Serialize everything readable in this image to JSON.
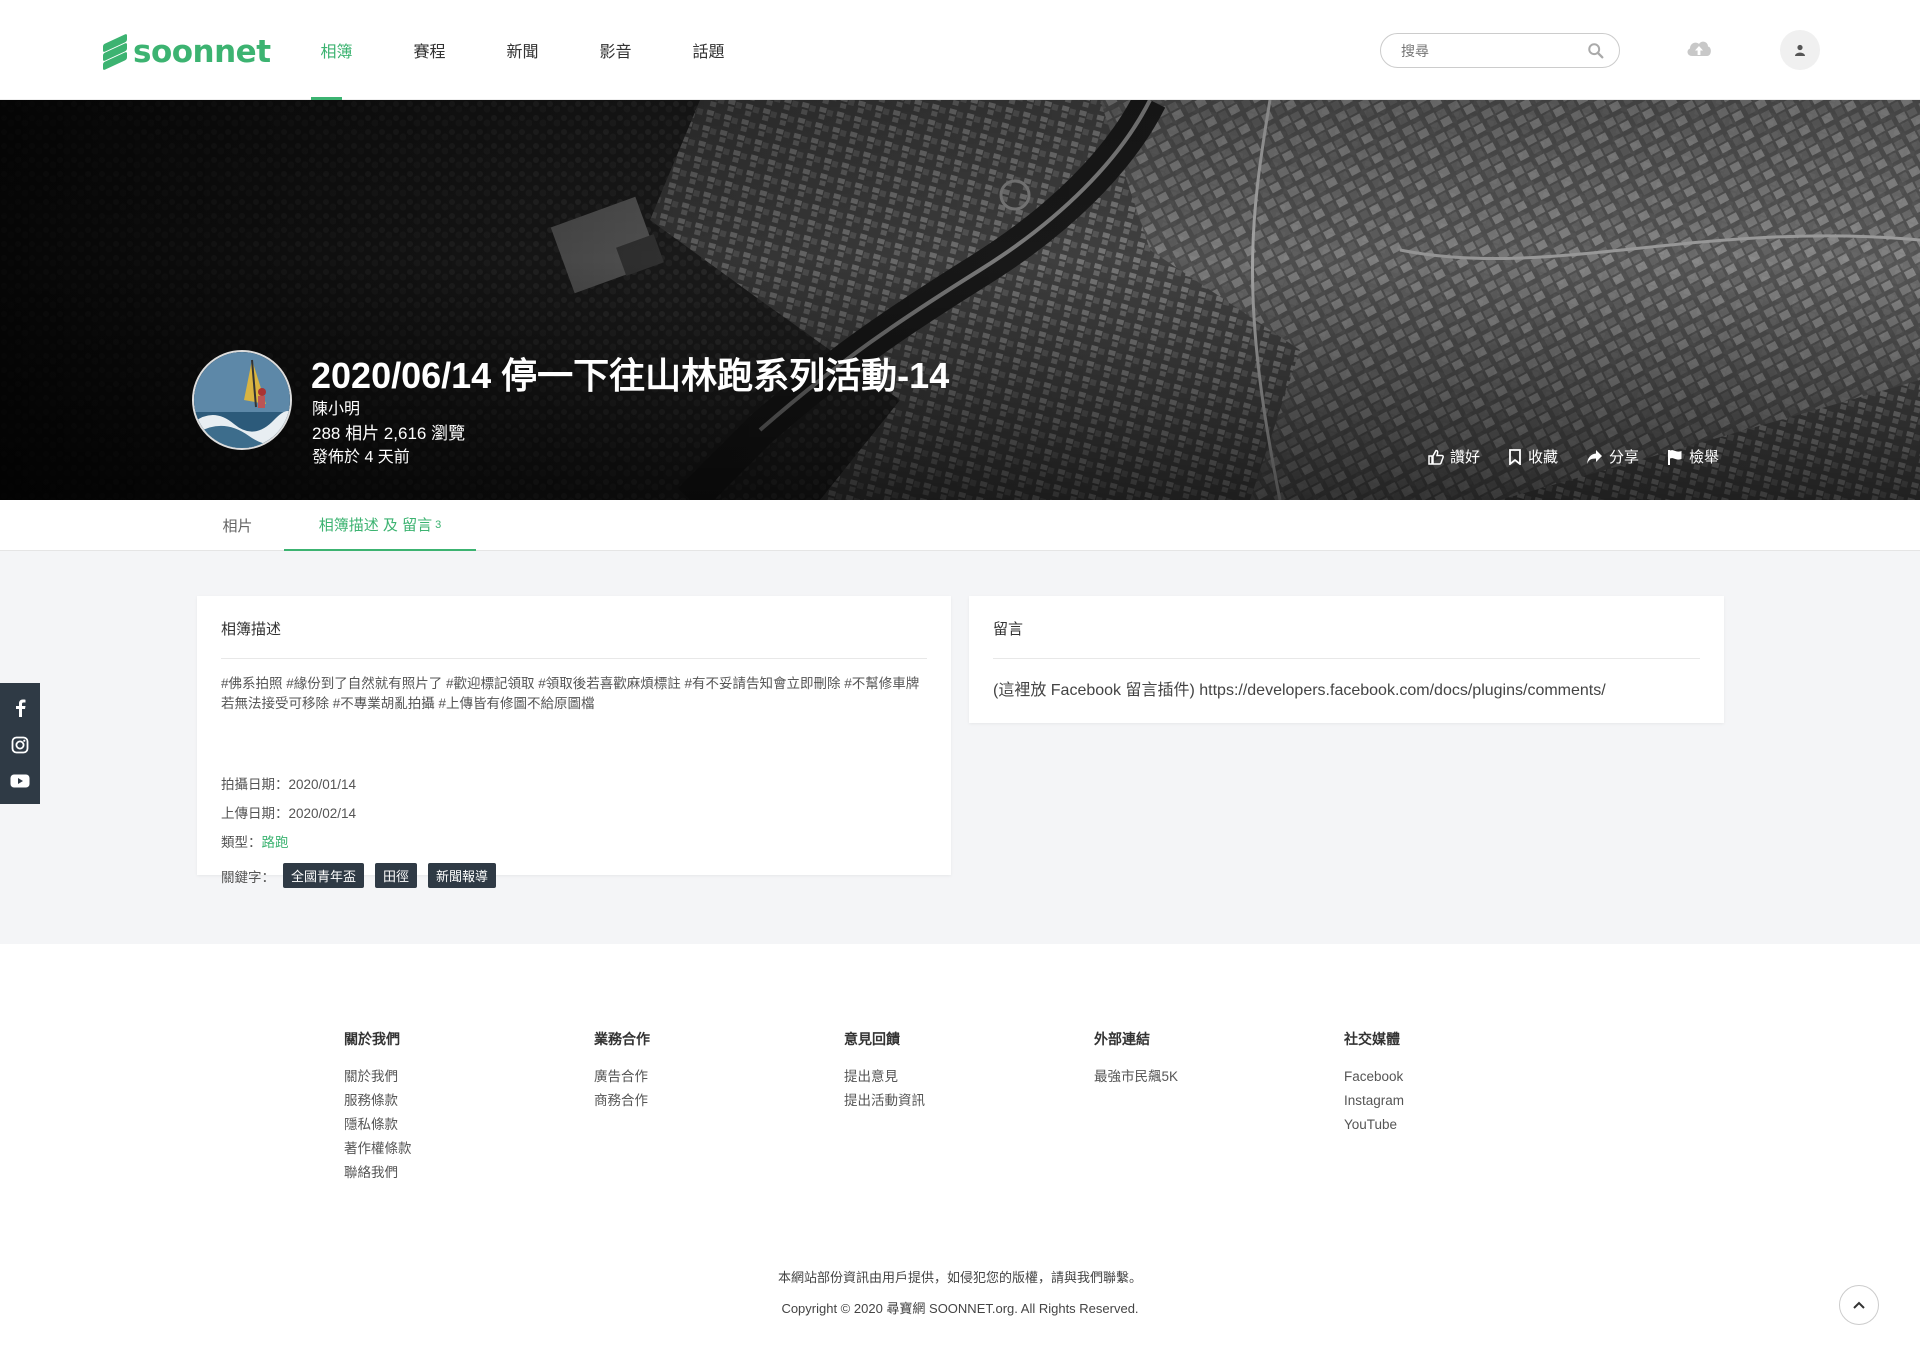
{
  "header": {
    "logo_text": "soonnet",
    "nav": [
      {
        "label": "相簿",
        "active": true
      },
      {
        "label": "賽程",
        "active": false
      },
      {
        "label": "新聞",
        "active": false
      },
      {
        "label": "影音",
        "active": false
      },
      {
        "label": "話題",
        "active": false
      }
    ],
    "search_placeholder": "搜尋"
  },
  "album": {
    "title": "2020/06/14 停一下往山林跑系列活動-14",
    "author": "陳小明",
    "stats": "288 相片 2,616 瀏覽",
    "posted": "發佈於 4 天前",
    "actions": [
      {
        "label": "讚好",
        "icon": "thumbs-up-icon"
      },
      {
        "label": "收藏",
        "icon": "bookmark-icon"
      },
      {
        "label": "分享",
        "icon": "share-icon"
      },
      {
        "label": "檢舉",
        "icon": "flag-icon"
      }
    ]
  },
  "tabs": {
    "photos": "相片",
    "desc_comments": "相簿描述 及 留言",
    "comment_count": "3"
  },
  "description": {
    "heading": "相簿描述",
    "text": "#佛系拍照 #緣份到了自然就有照片了 #歡迎標記領取 #領取後若喜歡麻煩標註 #有不妥請告知會立即刪除 #不幫修車牌若無法接受可移除 #不專業胡亂拍攝 #上傳皆有修圖不給原圖檔",
    "shot_date_label": "拍攝日期：",
    "shot_date": "2020/01/14",
    "upload_date_label": "上傳日期：",
    "upload_date": "2020/02/14",
    "type_label": "類型：",
    "type_value": "路跑",
    "keywords_label": "關鍵字：",
    "keywords": [
      "全國青年盃",
      "田徑",
      "新聞報導"
    ]
  },
  "comments": {
    "heading": "留言",
    "placeholder_text": "(這裡放 Facebook 留言插件) https://developers.facebook.com/docs/plugins/comments/"
  },
  "footer": {
    "columns": [
      {
        "title": "關於我們",
        "links": [
          "關於我們",
          "服務條款",
          "隱私條款",
          "著作權條款",
          "聯絡我們"
        ]
      },
      {
        "title": "業務合作",
        "links": [
          "廣告合作",
          "商務合作"
        ]
      },
      {
        "title": "意見回饋",
        "links": [
          "提出意見",
          "提出活動資訊"
        ]
      },
      {
        "title": "外部連結",
        "links": [
          "最強市民飆5K"
        ]
      },
      {
        "title": "社交媒體",
        "links": [
          "Facebook",
          "Instagram",
          "YouTube"
        ]
      }
    ],
    "notice": "本網站部份資訊由用戶提供，如侵犯您的版權，請與我們聯繫。",
    "copyright": "Copyright © 2020 尋寶網 SOONNET.org. All Rights Reserved."
  },
  "colors": {
    "accent": "#3cb371",
    "tag_bg": "#2f3a45",
    "page_bg": "#f4f5f7"
  }
}
